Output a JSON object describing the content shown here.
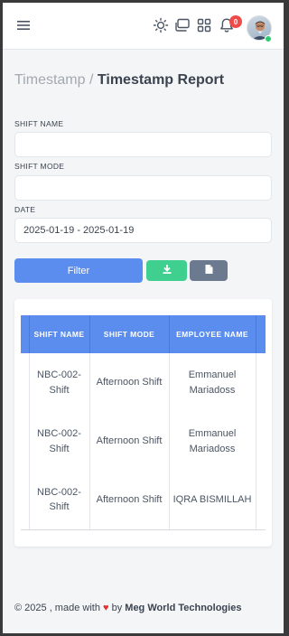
{
  "header": {
    "menu_icon": "hamburger-icon",
    "theme_icon": "sun-icon",
    "windows_icon": "windows-icon",
    "apps_icon": "grid-icon",
    "notification_icon": "bell-icon",
    "notification_count": "0",
    "avatar": "user-avatar",
    "status_color": "#2ecc71"
  },
  "breadcrumb": {
    "parent": "Timestamp",
    "separator": "/",
    "current": "Timestamp Report"
  },
  "form": {
    "shift_name_label": "SHIFT NAME",
    "shift_name_value": "",
    "shift_mode_label": "SHIFT MODE",
    "shift_mode_value": "",
    "date_label": "DATE",
    "date_value": "2025-01-19 - 2025-01-19"
  },
  "actions": {
    "filter_label": "Filter",
    "download_icon": "download-icon",
    "file_icon": "file-icon"
  },
  "table": {
    "columns": [
      "SHIFT NAME",
      "SHIFT MODE",
      "EMPLOYEE NAME"
    ],
    "rows": [
      {
        "shift_name": "NBC-002-Shift",
        "shift_mode": "Afternoon Shift",
        "employee_name": "Emmanuel Mariadoss"
      },
      {
        "shift_name": "NBC-002-Shift",
        "shift_mode": "Afternoon Shift",
        "employee_name": "Emmanuel Mariadoss"
      },
      {
        "shift_name": "NBC-002-Shift",
        "shift_mode": "Afternoon Shift",
        "employee_name": "IQRA BISMILLAH"
      }
    ]
  },
  "footer": {
    "prefix": "© 2025 , made with",
    "heart": "♥",
    "by": "by",
    "brand": "Meg World Technologies"
  },
  "colors": {
    "primary": "#5b8def",
    "success": "#3fcf8e",
    "secondary": "#6b7a8e",
    "danger": "#ef4b4b"
  }
}
